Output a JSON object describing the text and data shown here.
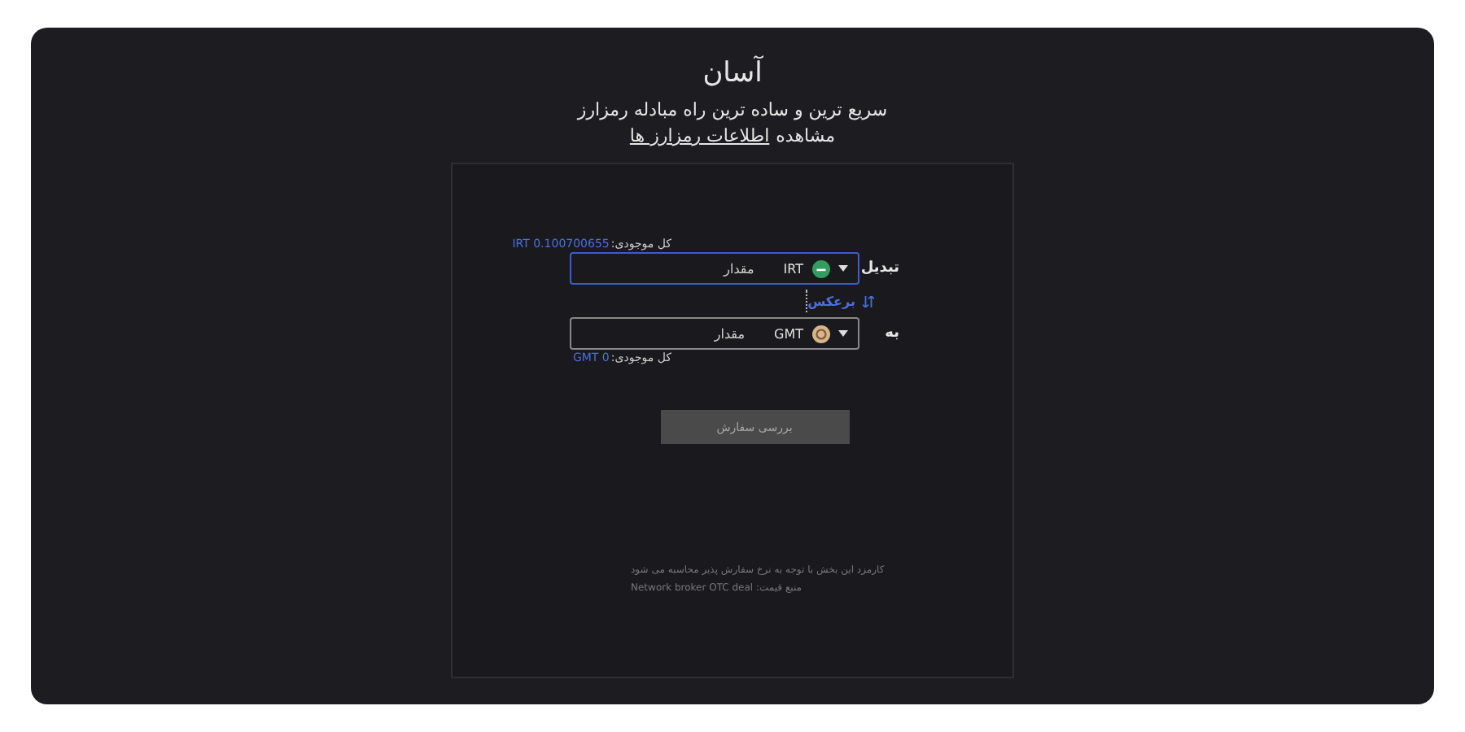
{
  "header": {
    "title": "آسان",
    "subtitle": "سریع ترین و ساده ترین راه مبادله رمزارز",
    "info_prefix": "مشاهده",
    "info_link": "اطلاعات رمزارز ها"
  },
  "form": {
    "from": {
      "balance_label": "کل موجودی:",
      "balance_value": "IRT 0.100700655",
      "label": "تبدیل",
      "currency": "IRT",
      "kind": "irt",
      "placeholder": "مقدار",
      "focused": true
    },
    "swap": {
      "label": "برعکس"
    },
    "to": {
      "balance_label": "کل موجودی:",
      "balance_value": "GMT 0",
      "label": "به",
      "currency": "GMT",
      "kind": "gmt",
      "placeholder": "مقدار",
      "focused": false
    },
    "submit": {
      "label": "بررسی سفارش",
      "disabled": true
    },
    "notes": [
      "کارمزد این بخش با توجه به نرخ سفارش پذیر محاسبه می شود",
      "منبع قیمت: Network broker OTC deal"
    ]
  }
}
